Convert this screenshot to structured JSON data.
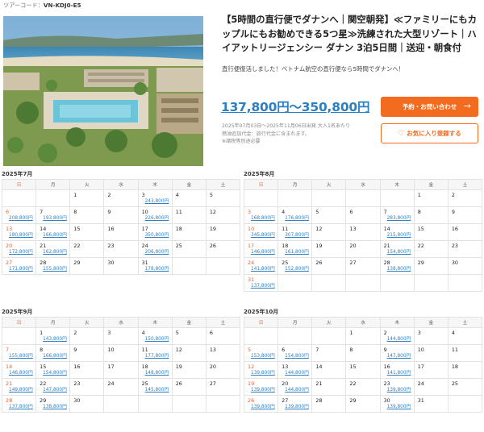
{
  "tour_code": {
    "label": "ツアーコード：",
    "value": "VN-KDJ0-E5"
  },
  "title": "【5時間の直行便でダナンへ｜関空朝発】≪ファミリーにもカップルにもお勧めできる5つ星≫洗練された大型リゾート｜ハイアットリージェンシー ダナン 3泊5日間｜送迎・朝食付",
  "lead": "直行便復活しました！ベトナム航空の直行便なら5時間でダナンへ！",
  "price": "137,800円〜350,800円",
  "notes": [
    "2025年07月03日〜2025年11月06日出発 大人1名あたり",
    "燃油追加代金：旅行代金に含まれます。",
    "※諸税等別途必要"
  ],
  "buttons": {
    "inquiry": "予約・お問い合わせ",
    "inquiry_arrow": "→",
    "favorite": "お気に入り登録する",
    "heart": "♡"
  },
  "weekdays": [
    "日",
    "月",
    "火",
    "水",
    "木",
    "金",
    "土"
  ],
  "colors": {
    "accent": "#f26b1f",
    "price": "#2b7fc3",
    "sunday": "#e8602c"
  },
  "calendars": [
    {
      "month": "2025年7月",
      "weeks": [
        [
          null,
          null,
          {
            "d": "1"
          },
          {
            "d": "2"
          },
          {
            "d": "3",
            "p": "243,800円"
          },
          {
            "d": "4"
          },
          {
            "d": "5"
          }
        ],
        [
          {
            "d": "6",
            "p": "208,800円"
          },
          {
            "d": "7",
            "p": "193,800円"
          },
          {
            "d": "8"
          },
          {
            "d": "9"
          },
          {
            "d": "10",
            "p": "226,800円"
          },
          {
            "d": "11"
          },
          {
            "d": "12"
          }
        ],
        [
          {
            "d": "13",
            "p": "180,800円"
          },
          {
            "d": "14",
            "p": "166,800円"
          },
          {
            "d": "15"
          },
          {
            "d": "16"
          },
          {
            "d": "17",
            "p": "350,800円"
          },
          {
            "d": "18"
          },
          {
            "d": "19"
          }
        ],
        [
          {
            "d": "20",
            "p": "172,800円"
          },
          {
            "d": "21",
            "p": "162,800円"
          },
          {
            "d": "22"
          },
          {
            "d": "23"
          },
          {
            "d": "24",
            "p": "206,800円"
          },
          {
            "d": "25"
          },
          {
            "d": "26"
          }
        ],
        [
          {
            "d": "27",
            "p": "171,800円"
          },
          {
            "d": "28",
            "p": "155,800円"
          },
          {
            "d": "29"
          },
          {
            "d": "30"
          },
          {
            "d": "31",
            "p": "178,800円"
          },
          null,
          null
        ]
      ]
    },
    {
      "month": "2025年8月",
      "weeks": [
        [
          null,
          null,
          null,
          null,
          null,
          {
            "d": "1"
          },
          {
            "d": "2"
          }
        ],
        [
          {
            "d": "3",
            "p": "168,800円"
          },
          {
            "d": "4",
            "p": "176,800円"
          },
          {
            "d": "5"
          },
          {
            "d": "6"
          },
          {
            "d": "7",
            "p": "283,800円"
          },
          {
            "d": "8"
          },
          {
            "d": "9"
          }
        ],
        [
          {
            "d": "10",
            "p": "345,800円"
          },
          {
            "d": "11",
            "p": "307,800円"
          },
          {
            "d": "12"
          },
          {
            "d": "13"
          },
          {
            "d": "14",
            "p": "215,800円"
          },
          {
            "d": "15"
          },
          {
            "d": "16"
          }
        ],
        [
          {
            "d": "17",
            "p": "146,800円"
          },
          {
            "d": "18",
            "p": "161,800円"
          },
          {
            "d": "19"
          },
          {
            "d": "20"
          },
          {
            "d": "21",
            "p": "154,800円"
          },
          {
            "d": "22"
          },
          {
            "d": "23"
          }
        ],
        [
          {
            "d": "24",
            "p": "141,800円"
          },
          {
            "d": "25",
            "p": "152,800円"
          },
          {
            "d": "26"
          },
          {
            "d": "27"
          },
          {
            "d": "28",
            "p": "138,800円"
          },
          {
            "d": "29"
          },
          {
            "d": "30"
          }
        ],
        [
          {
            "d": "31",
            "p": "137,800円"
          },
          null,
          null,
          null,
          null,
          null,
          null
        ]
      ]
    },
    {
      "month": "2025年9月",
      "weeks": [
        [
          null,
          {
            "d": "1",
            "p": "143,800円"
          },
          {
            "d": "2"
          },
          {
            "d": "3"
          },
          {
            "d": "4",
            "p": "150,800円"
          },
          {
            "d": "5"
          },
          {
            "d": "6"
          }
        ],
        [
          {
            "d": "7",
            "p": "155,800円"
          },
          {
            "d": "8",
            "p": "166,800円"
          },
          {
            "d": "9"
          },
          {
            "d": "10"
          },
          {
            "d": "11",
            "p": "177,800円"
          },
          {
            "d": "12"
          },
          {
            "d": "13"
          }
        ],
        [
          {
            "d": "14",
            "p": "146,800円"
          },
          {
            "d": "15",
            "p": "154,800円"
          },
          {
            "d": "16"
          },
          {
            "d": "17"
          },
          {
            "d": "18",
            "p": "148,800円"
          },
          {
            "d": "19"
          },
          {
            "d": "20"
          }
        ],
        [
          {
            "d": "21",
            "p": "149,800円"
          },
          {
            "d": "22",
            "p": "147,800円"
          },
          {
            "d": "23"
          },
          {
            "d": "24"
          },
          {
            "d": "25",
            "p": "145,800円"
          },
          {
            "d": "26"
          },
          {
            "d": "27"
          }
        ],
        [
          {
            "d": "28",
            "p": "137,800円"
          },
          {
            "d": "29",
            "p": "138,800円"
          },
          {
            "d": "30"
          },
          null,
          null,
          null,
          null
        ]
      ]
    },
    {
      "month": "2025年10月",
      "weeks": [
        [
          null,
          null,
          null,
          {
            "d": "1"
          },
          {
            "d": "2",
            "p": "144,800円"
          },
          {
            "d": "3"
          },
          {
            "d": "4"
          }
        ],
        [
          {
            "d": "5",
            "p": "153,800円"
          },
          {
            "d": "6",
            "p": "154,800円"
          },
          {
            "d": "7"
          },
          {
            "d": "8"
          },
          {
            "d": "9",
            "p": "147,800円"
          },
          {
            "d": "10"
          },
          {
            "d": "11"
          }
        ],
        [
          {
            "d": "12",
            "p": "139,800円"
          },
          {
            "d": "13",
            "p": "144,800円"
          },
          {
            "d": "14"
          },
          {
            "d": "15"
          },
          {
            "d": "16",
            "p": "141,800円"
          },
          {
            "d": "17"
          },
          {
            "d": "18"
          }
        ],
        [
          {
            "d": "19",
            "p": "139,800円"
          },
          {
            "d": "20",
            "p": "144,800円"
          },
          {
            "d": "21"
          },
          {
            "d": "22"
          },
          {
            "d": "23",
            "p": "139,800円"
          },
          {
            "d": "24"
          },
          {
            "d": "25"
          }
        ],
        [
          {
            "d": "26",
            "p": "139,800円"
          },
          {
            "d": "27",
            "p": "139,800円"
          },
          {
            "d": "28"
          },
          {
            "d": "29"
          },
          {
            "d": "30",
            "p": "139,800円"
          },
          {
            "d": "31"
          },
          null
        ]
      ]
    }
  ]
}
